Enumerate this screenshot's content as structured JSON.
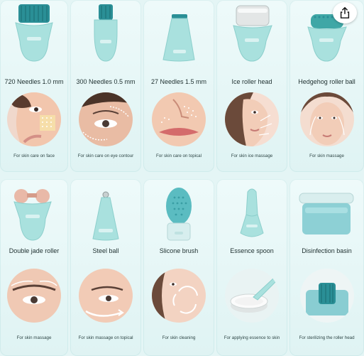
{
  "colors": {
    "mint": "#a9e1de",
    "mint_dark": "#6cc7c4",
    "teal": "#2a8f96",
    "skin": "#f2c6ad"
  },
  "row1": [
    {
      "name": "720 Needles 1.0 mm",
      "caption": "For skin care on face",
      "icon": "derma-roller-720"
    },
    {
      "name": "300 Needles 0.5 mm",
      "caption": "For skin care on eye contour",
      "icon": "derma-roller-300"
    },
    {
      "name": "27 Needles 1.5 mm",
      "caption": "For skin care on topical",
      "icon": "derma-stamp-27"
    },
    {
      "name": "Ice roller head",
      "caption": "For skin ice massage",
      "icon": "ice-roller"
    },
    {
      "name": "Hedgehog roller ball",
      "caption": "For skin massage",
      "icon": "hedgehog-roller"
    }
  ],
  "row2": [
    {
      "name": "Double jade roller",
      "caption": "For skin massage",
      "icon": "jade-roller"
    },
    {
      "name": "Steel ball",
      "caption": "For skin massage on topical",
      "icon": "steel-ball"
    },
    {
      "name": "Slicone brush",
      "caption": "For skin cleaning",
      "icon": "silicone-brush"
    },
    {
      "name": "Essence spoon",
      "caption": "For applying essence to skin",
      "icon": "essence-spoon"
    },
    {
      "name": "Disinfection basin",
      "caption": "For sterilizing the roller head",
      "icon": "disinfection-basin"
    }
  ],
  "share": {
    "icon": "share-icon"
  }
}
